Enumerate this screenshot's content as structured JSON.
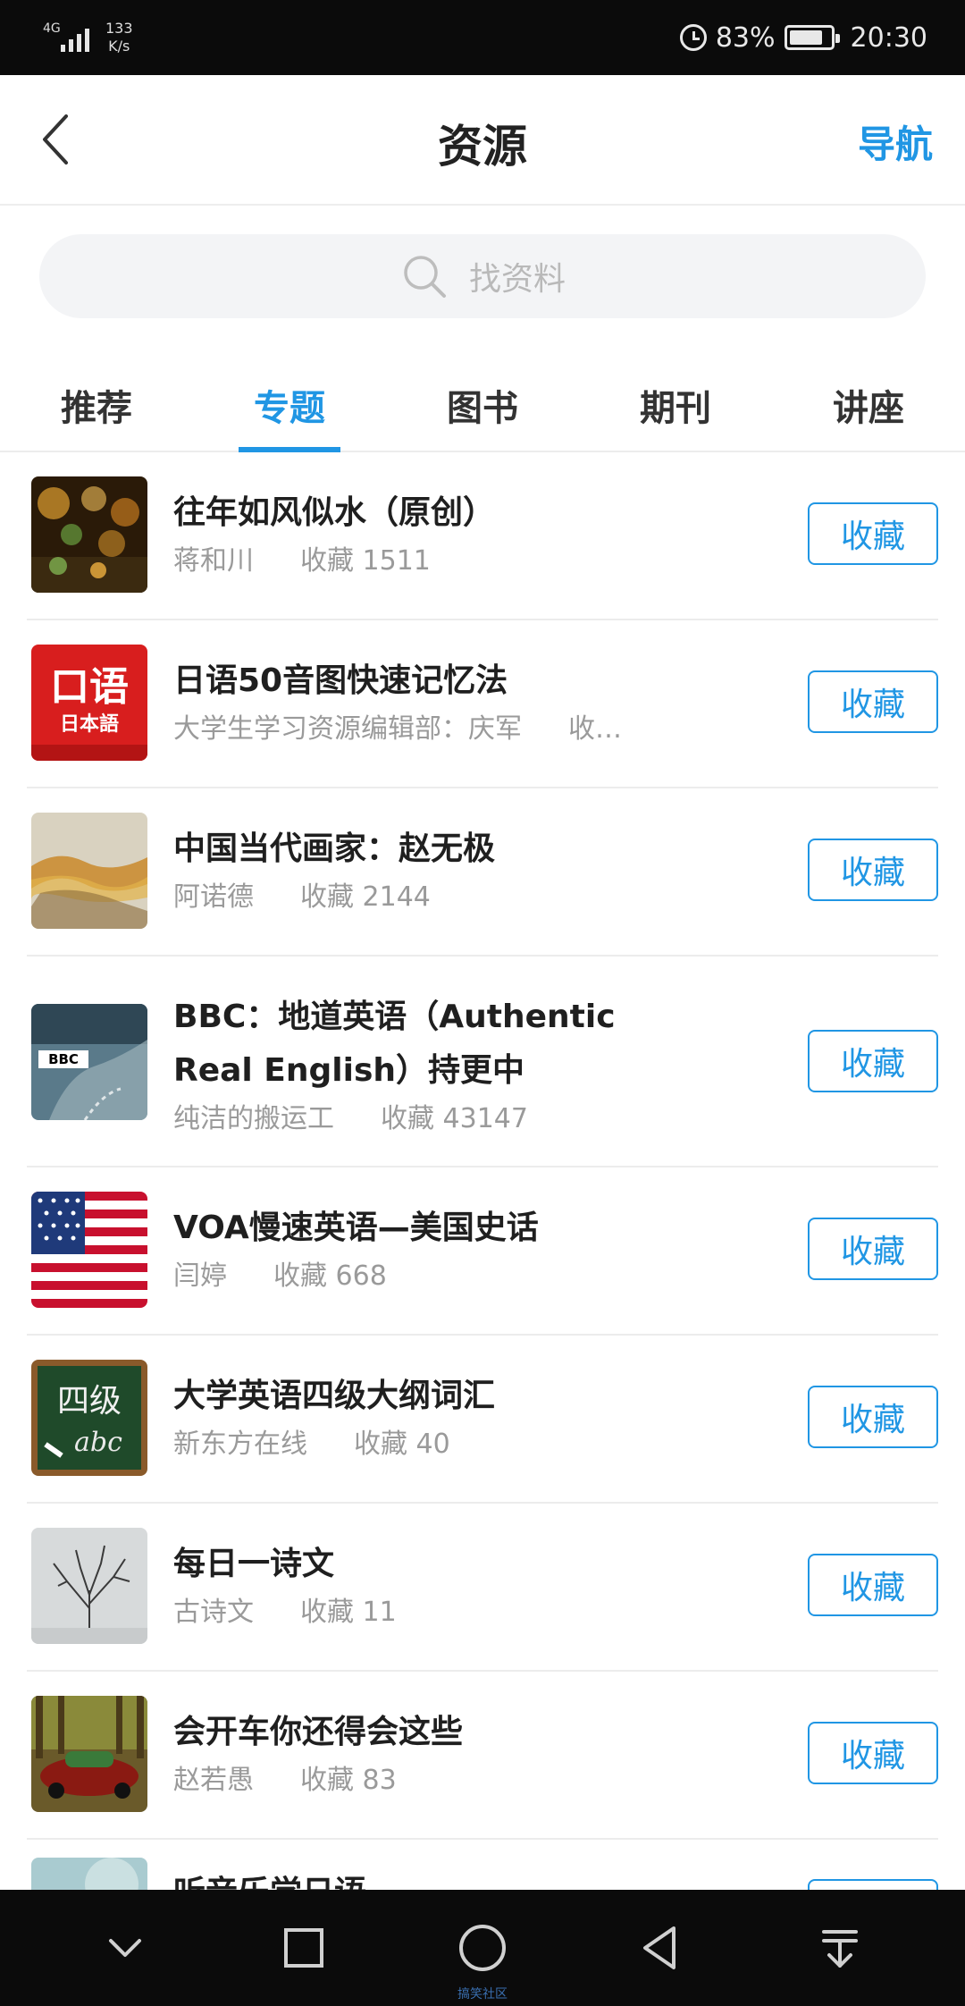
{
  "status_bar": {
    "network": "4G",
    "speed_value": "133",
    "speed_unit": "K/s",
    "battery": "83%",
    "battery_level": 0.83,
    "time": "20:30"
  },
  "header": {
    "title": "资源",
    "nav_label": "导航"
  },
  "search": {
    "placeholder": "找资料"
  },
  "tabs": [
    {
      "label": "推荐",
      "active": false
    },
    {
      "label": "专题",
      "active": true
    },
    {
      "label": "图书",
      "active": false
    },
    {
      "label": "期刊",
      "active": false
    },
    {
      "label": "讲座",
      "active": false
    }
  ],
  "items": [
    {
      "title": "往年如风似水（原创）",
      "author": "蒋和川",
      "favorites": "收藏 1511",
      "button": "收藏"
    },
    {
      "title": "日语50音图快速记忆法",
      "author": "大学生学习资源编辑部：庆军",
      "favorites": "收…",
      "button": "收藏"
    },
    {
      "title": "中国当代画家：赵无极",
      "author": "阿诺德",
      "favorites": "收藏 2144",
      "button": "收藏"
    },
    {
      "title": "BBC：地道英语（Authentic Real English）持更中",
      "author": "纯洁的搬运工",
      "favorites": "收藏 43147",
      "button": "收藏"
    },
    {
      "title": "VOA慢速英语—美国史话",
      "author": "闫婷",
      "favorites": "收藏 668",
      "button": "收藏"
    },
    {
      "title": "大学英语四级大纲词汇",
      "author": "新东方在线",
      "favorites": "收藏 40",
      "button": "收藏"
    },
    {
      "title": "每日一诗文",
      "author": "古诗文",
      "favorites": "收藏 11",
      "button": "收藏"
    },
    {
      "title": "会开车你还得会这些",
      "author": "赵若愚",
      "favorites": "收藏 83",
      "button": "收藏"
    },
    {
      "title": "听音乐学日语",
      "button": "收藏"
    }
  ],
  "thumb_labels": {
    "japanese_big": "口语",
    "japanese_small": "日本語",
    "bbc": "BBC",
    "cet4": "四级",
    "abc": "abc"
  },
  "watermark": "搞笑社区"
}
